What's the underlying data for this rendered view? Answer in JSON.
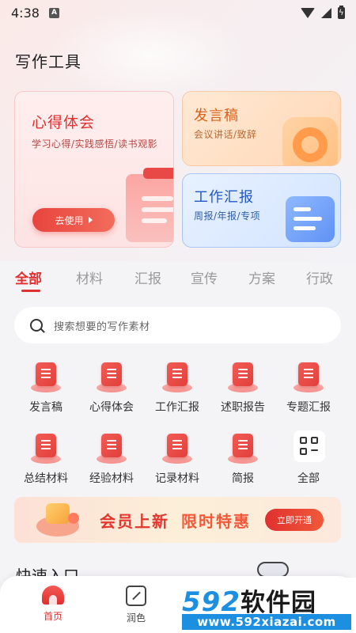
{
  "status_bar": {
    "time": "4:38",
    "notification_badge": "A"
  },
  "page": {
    "title": "写作工具"
  },
  "cards": {
    "xinde": {
      "title": "心得体会",
      "subtitle": "学习心得/实践感悟/读书观影",
      "button": "去使用"
    },
    "fayan": {
      "title": "发言稿",
      "subtitle": "会议讲话/致辞"
    },
    "huibao": {
      "title": "工作汇报",
      "subtitle": "周报/年报/专项"
    }
  },
  "tabs": [
    {
      "label": "全部",
      "active": true
    },
    {
      "label": "材料",
      "active": false
    },
    {
      "label": "汇报",
      "active": false
    },
    {
      "label": "宣传",
      "active": false
    },
    {
      "label": "方案",
      "active": false
    },
    {
      "label": "行政",
      "active": false
    }
  ],
  "search": {
    "placeholder": "搜索想要的写作素材"
  },
  "grid": [
    {
      "label": "发言稿",
      "icon": "speech-doc-icon"
    },
    {
      "label": "心得体会",
      "icon": "notebook-icon"
    },
    {
      "label": "工作汇报",
      "icon": "report-cloud-icon"
    },
    {
      "label": "述职报告",
      "icon": "books-icon"
    },
    {
      "label": "专题汇报",
      "icon": "chart-board-icon"
    },
    {
      "label": "总结材料",
      "icon": "mic-icon"
    },
    {
      "label": "经验材料",
      "icon": "doc-list-icon"
    },
    {
      "label": "记录材料",
      "icon": "grid-doc-icon"
    },
    {
      "label": "简报",
      "icon": "brief-icon"
    },
    {
      "label": "全部",
      "icon": "all-apps-icon"
    }
  ],
  "banner": {
    "text_part1": "会员上新",
    "text_part2": "限时特惠",
    "button": "立即开通"
  },
  "quick_entry": {
    "title": "快速入口"
  },
  "bottom_nav": [
    {
      "label": "首页",
      "active": true
    },
    {
      "label": "润色",
      "active": false
    }
  ],
  "watermark": {
    "digits": "592",
    "cn": "软件园",
    "url": "www.592xiazai.com"
  },
  "colors": {
    "accent": "#e0302f",
    "orange": "#d9621c",
    "blue": "#2257c6",
    "background": "#f4f3f6"
  }
}
